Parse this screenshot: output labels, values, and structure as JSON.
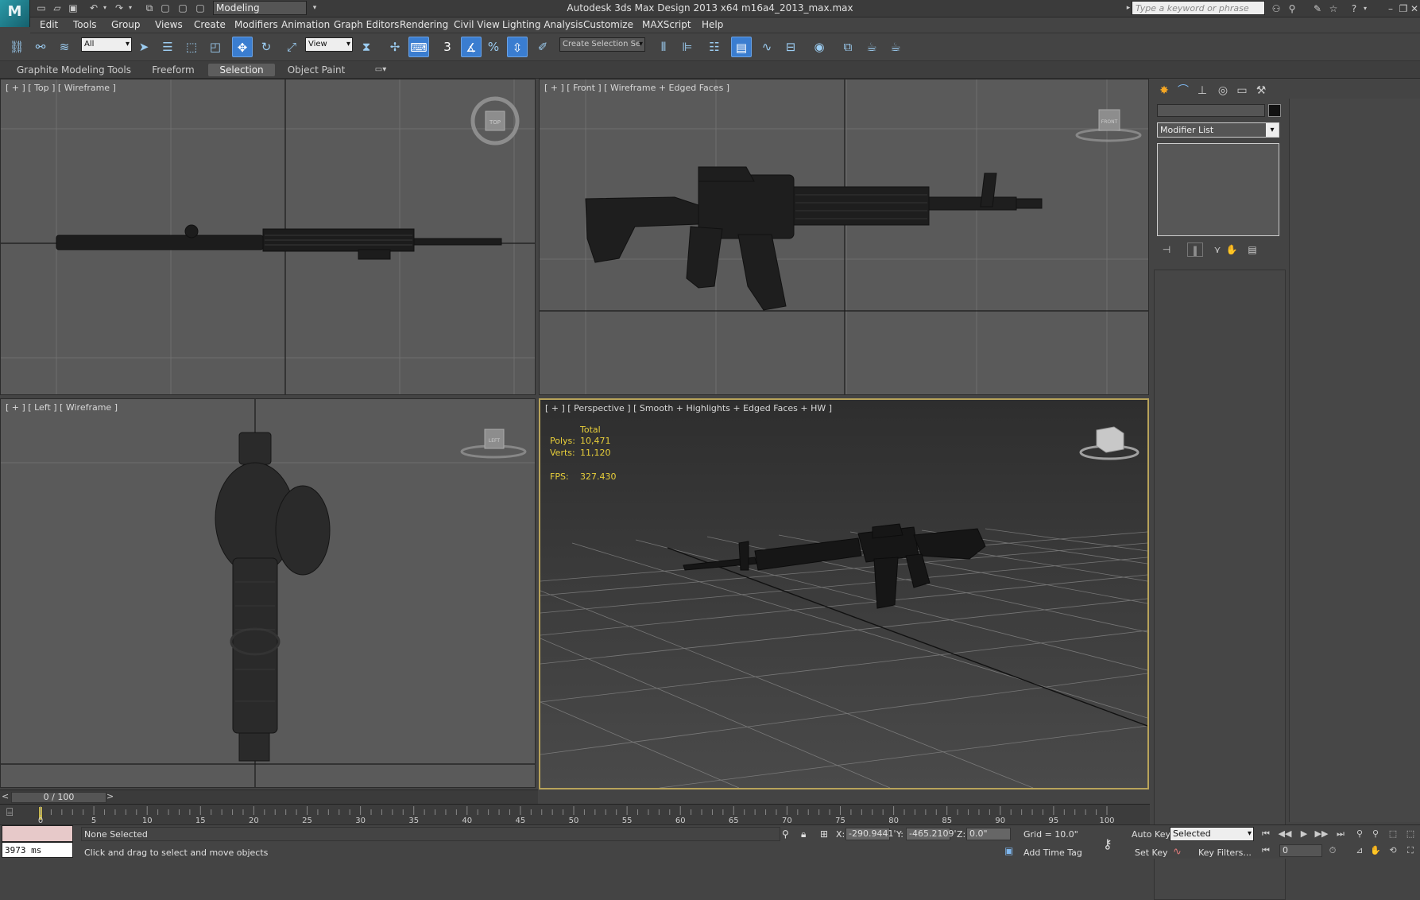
{
  "app": {
    "logo_text": "M",
    "title": "Autodesk 3ds Max Design 2013 x64      m16a4_2013_max.max",
    "workspace": "Modeling",
    "search_placeholder": "Type a keyword or phrase"
  },
  "menu": [
    "Edit",
    "Tools",
    "Group",
    "Views",
    "Create",
    "Modifiers",
    "Animation",
    "Graph Editors",
    "Rendering",
    "Civil View",
    "Lighting Analysis",
    "Customize",
    "MAXScript",
    "Help"
  ],
  "toolbar": {
    "selection_filter": "All",
    "ref_coord": "View",
    "snap_label": "3",
    "named_selection": "Create Selection Se"
  },
  "ribbon": {
    "tabs": [
      "Graphite Modeling Tools",
      "Freeform",
      "Selection",
      "Object Paint"
    ],
    "active": "Selection"
  },
  "viewports": {
    "top": {
      "label": "[ + ] [ Top ] [ Wireframe ]",
      "cube": "TOP"
    },
    "front": {
      "label": "[ + ] [ Front ] [ Wireframe + Edged Faces ]",
      "cube": "FRONT"
    },
    "left": {
      "label": "[ + ] [ Left ] [ Wireframe ]",
      "cube": "LEFT"
    },
    "perspective": {
      "label": "[ + ] [ Perspective ] [ Smooth + Highlights + Edged Faces + HW ]",
      "stats_header": "Total",
      "polys_label": "Polys:",
      "polys": "10,471",
      "verts_label": "Verts:",
      "verts": "11,120",
      "fps_label": "FPS:",
      "fps": "327.430"
    }
  },
  "command_panel": {
    "modifier_list": "Modifier List"
  },
  "timeline": {
    "slider": "0 / 100",
    "ticks": [
      "0",
      "5",
      "10",
      "15",
      "20",
      "25",
      "30",
      "35",
      "40",
      "45",
      "50",
      "55",
      "60",
      "65",
      "70",
      "75",
      "80",
      "85",
      "90",
      "95",
      "100"
    ]
  },
  "status": {
    "listener_output": "3973 ms",
    "selection": "None Selected",
    "prompt": "Click and drag to select and move objects",
    "x_label": "X:",
    "x": "-290.9441'",
    "y_label": "Y:",
    "y": "-465.2109'",
    "z_label": "Z:",
    "z": "0.0\"",
    "grid": "Grid = 10.0\"",
    "add_time_tag": "Add Time Tag",
    "auto_key": "Auto Key",
    "set_key": "Set Key",
    "key_mode": "Selected",
    "key_filters": "Key Filters...",
    "frame": "0"
  }
}
